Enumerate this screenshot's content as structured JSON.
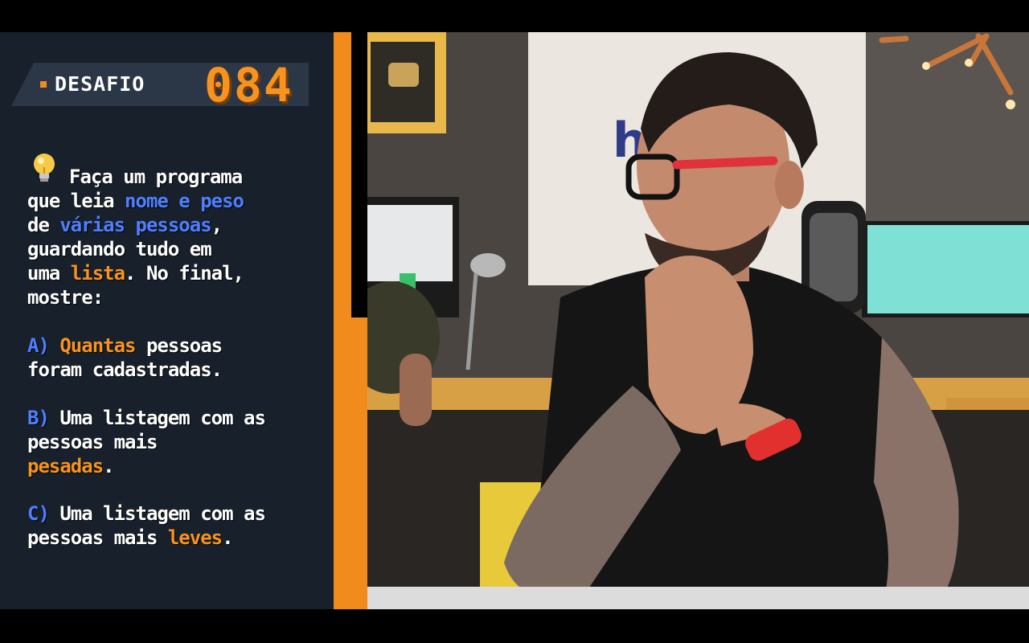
{
  "challenge": {
    "label": "DESAFIO",
    "number": "084"
  },
  "prompt": {
    "line1": "Faça um programa",
    "line2_a": "que leia ",
    "line2_b": "nome e peso",
    "line3_a": "de ",
    "line3_b": "várias pessoas",
    "line3_c": ",",
    "line4": "guardando tudo em",
    "line5_a": "uma ",
    "line5_b": "lista",
    "line5_c": ". No final,",
    "line6": "mostre:"
  },
  "items": [
    {
      "letter": "A)",
      "parts": [
        {
          "text": " ",
          "style": "white"
        },
        {
          "text": "Quantas",
          "style": "orange"
        },
        {
          "text": " pessoas",
          "style": "white"
        }
      ],
      "line2": [
        {
          "text": "foram cadastradas.",
          "style": "white"
        }
      ]
    },
    {
      "letter": "B)",
      "parts": [
        {
          "text": " Uma listagem com as",
          "style": "white"
        }
      ],
      "line2": [
        {
          "text": "pessoas mais",
          "style": "white"
        }
      ],
      "line3": [
        {
          "text": "pesadas",
          "style": "orange"
        },
        {
          "text": ".",
          "style": "white"
        }
      ]
    },
    {
      "letter": "C)",
      "parts": [
        {
          "text": " Uma listagem com as",
          "style": "white"
        }
      ],
      "line2": [
        {
          "text": "pessoas mais ",
          "style": "white"
        },
        {
          "text": "leves",
          "style": "orange"
        },
        {
          "text": ".",
          "style": "white"
        }
      ]
    }
  ],
  "colors": {
    "accent_orange": "#f18b1c",
    "highlight_blue": "#4f7fff",
    "panel_bg": "#17202b"
  },
  "icons": {
    "bulb": "lightbulb-icon"
  }
}
